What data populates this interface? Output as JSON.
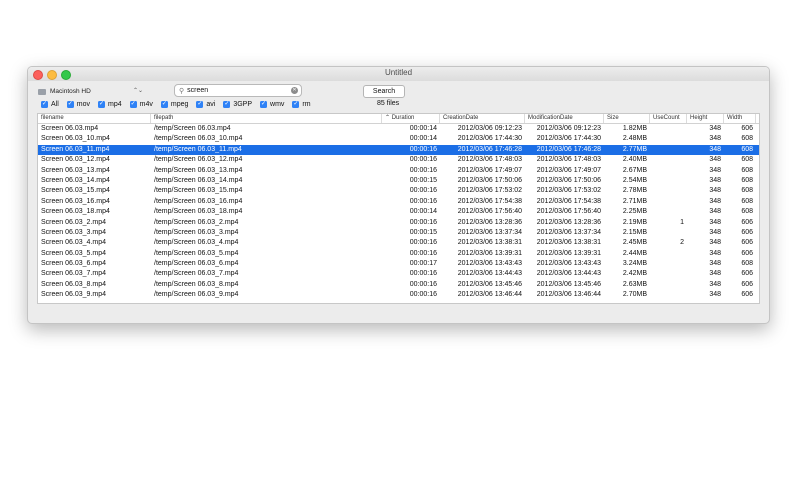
{
  "window": {
    "title": "Untitled"
  },
  "toolbar": {
    "volume": "Macintosh HD",
    "search_value": "screen",
    "search_button": "Search",
    "file_count": "85 files"
  },
  "filters": [
    {
      "label": "All",
      "checked": true
    },
    {
      "label": "mov",
      "checked": true
    },
    {
      "label": "mp4",
      "checked": true
    },
    {
      "label": "m4v",
      "checked": true
    },
    {
      "label": "mpeg",
      "checked": true
    },
    {
      "label": "avi",
      "checked": true
    },
    {
      "label": "3GPP",
      "checked": true
    },
    {
      "label": "wmv",
      "checked": true
    },
    {
      "label": "rm",
      "checked": true
    }
  ],
  "table": {
    "columns": [
      "filename",
      "filepath",
      "Duration",
      "CreationDate",
      "ModificationDate",
      "Size",
      "UseCount",
      "Height",
      "Width"
    ],
    "selected_index": 2,
    "rows": [
      [
        "Screen 06.03.mp4",
        "/temp/Screen 06.03.mp4",
        "00:00:14",
        "2012/03/06 09:12:23",
        "2012/03/06 09:12:23",
        "1.82MB",
        "",
        "348",
        "606"
      ],
      [
        "Screen 06.03_10.mp4",
        "/temp/Screen 06.03_10.mp4",
        "00:00:14",
        "2012/03/06 17:44:30",
        "2012/03/06 17:44:30",
        "2.48MB",
        "",
        "348",
        "608"
      ],
      [
        "Screen 06.03_11.mp4",
        "/temp/Screen 06.03_11.mp4",
        "00:00:16",
        "2012/03/06 17:46:28",
        "2012/03/06 17:46:28",
        "2.77MB",
        "",
        "348",
        "608"
      ],
      [
        "Screen 06.03_12.mp4",
        "/temp/Screen 06.03_12.mp4",
        "00:00:16",
        "2012/03/06 17:48:03",
        "2012/03/06 17:48:03",
        "2.40MB",
        "",
        "348",
        "608"
      ],
      [
        "Screen 06.03_13.mp4",
        "/temp/Screen 06.03_13.mp4",
        "00:00:16",
        "2012/03/06 17:49:07",
        "2012/03/06 17:49:07",
        "2.67MB",
        "",
        "348",
        "608"
      ],
      [
        "Screen 06.03_14.mp4",
        "/temp/Screen 06.03_14.mp4",
        "00:00:15",
        "2012/03/06 17:50:06",
        "2012/03/06 17:50:06",
        "2.54MB",
        "",
        "348",
        "608"
      ],
      [
        "Screen 06.03_15.mp4",
        "/temp/Screen 06.03_15.mp4",
        "00:00:16",
        "2012/03/06 17:53:02",
        "2012/03/06 17:53:02",
        "2.78MB",
        "",
        "348",
        "608"
      ],
      [
        "Screen 06.03_16.mp4",
        "/temp/Screen 06.03_16.mp4",
        "00:00:16",
        "2012/03/06 17:54:38",
        "2012/03/06 17:54:38",
        "2.71MB",
        "",
        "348",
        "608"
      ],
      [
        "Screen 06.03_18.mp4",
        "/temp/Screen 06.03_18.mp4",
        "00:00:14",
        "2012/03/06 17:56:40",
        "2012/03/06 17:56:40",
        "2.25MB",
        "",
        "348",
        "608"
      ],
      [
        "Screen 06.03_2.mp4",
        "/temp/Screen 06.03_2.mp4",
        "00:00:16",
        "2012/03/06 13:28:36",
        "2012/03/06 13:28:36",
        "2.19MB",
        "1",
        "348",
        "606"
      ],
      [
        "Screen 06.03_3.mp4",
        "/temp/Screen 06.03_3.mp4",
        "00:00:15",
        "2012/03/06 13:37:34",
        "2012/03/06 13:37:34",
        "2.15MB",
        "",
        "348",
        "606"
      ],
      [
        "Screen 06.03_4.mp4",
        "/temp/Screen 06.03_4.mp4",
        "00:00:16",
        "2012/03/06 13:38:31",
        "2012/03/06 13:38:31",
        "2.45MB",
        "2",
        "348",
        "606"
      ],
      [
        "Screen 06.03_5.mp4",
        "/temp/Screen 06.03_5.mp4",
        "00:00:16",
        "2012/03/06 13:39:31",
        "2012/03/06 13:39:31",
        "2.44MB",
        "",
        "348",
        "606"
      ],
      [
        "Screen 06.03_6.mp4",
        "/temp/Screen 06.03_6.mp4",
        "00:00:17",
        "2012/03/06 13:43:43",
        "2012/03/06 13:43:43",
        "3.24MB",
        "",
        "348",
        "608"
      ],
      [
        "Screen 06.03_7.mp4",
        "/temp/Screen 06.03_7.mp4",
        "00:00:16",
        "2012/03/06 13:44:43",
        "2012/03/06 13:44:43",
        "2.42MB",
        "",
        "348",
        "606"
      ],
      [
        "Screen 06.03_8.mp4",
        "/temp/Screen 06.03_8.mp4",
        "00:00:16",
        "2012/03/06 13:45:46",
        "2012/03/06 13:45:46",
        "2.63MB",
        "",
        "348",
        "606"
      ],
      [
        "Screen 06.03_9.mp4",
        "/temp/Screen 06.03_9.mp4",
        "00:00:16",
        "2012/03/06 13:46:44",
        "2012/03/06 13:46:44",
        "2.70MB",
        "",
        "348",
        "606"
      ]
    ]
  },
  "icons": {
    "disk": "hard-drive-icon",
    "popup": "updown-chevron-icon",
    "search": "magnifier-icon",
    "clear": "clear-x-icon",
    "checkbox": "check-icon",
    "sort": "sort-ascending-icon"
  },
  "colors": {
    "selection": "#1b6ee6",
    "checkbox": "#2f82f6",
    "close": "#fc605c",
    "minimize": "#fdbc40",
    "zoom": "#34c84a"
  }
}
